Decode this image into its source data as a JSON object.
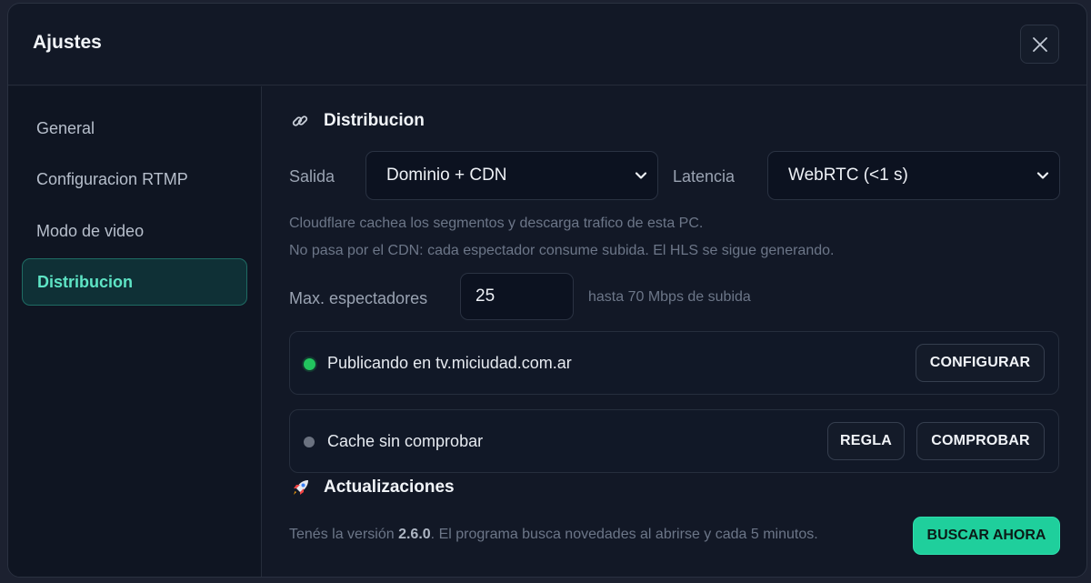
{
  "modal": {
    "title": "Ajustes",
    "close_icon": "close-icon"
  },
  "sidebar": {
    "items": [
      {
        "label": "General"
      },
      {
        "label": "Configuracion RTMP"
      },
      {
        "label": "Modo de video"
      },
      {
        "label": "Distribucion",
        "active": true
      }
    ]
  },
  "distribution": {
    "title": "Distribucion",
    "icon": "link-icon",
    "output_label": "Salida",
    "output_value": "Dominio + CDN",
    "latency_label": "Latencia",
    "latency_value": "WebRTC (<1 s)",
    "hint_line1": "Cloudflare cachea los segmentos y descarga trafico de esta PC.",
    "hint_line2": "No pasa por el CDN: cada espectador consume subida. El HLS se sigue generando.",
    "max_viewers_label": "Max. espectadores",
    "max_viewers_value": "25",
    "upload_hint": "hasta 70 Mbps de subida",
    "publish_status": "Publicando en tv.miciudad.com.ar",
    "publish_status_color": "#22c55e",
    "configure_button": "CONFIGURAR",
    "cache_status": "Cache sin comprobar",
    "cache_status_color": "#6b7280",
    "rule_button": "REGLA",
    "check_button": "COMPROBAR"
  },
  "updates": {
    "title": "Actualizaciones",
    "icon": "rocket-icon",
    "info_prefix": "Tenés la versión",
    "version": "2.6.0",
    "info_suffix": ". El programa busca novedades al abrirse y cada 5 minutos.",
    "search_button": "BUSCAR AHORA"
  },
  "colors": {
    "accent": "#1fcf9c",
    "active_nav_text": "#5ee4c5"
  }
}
